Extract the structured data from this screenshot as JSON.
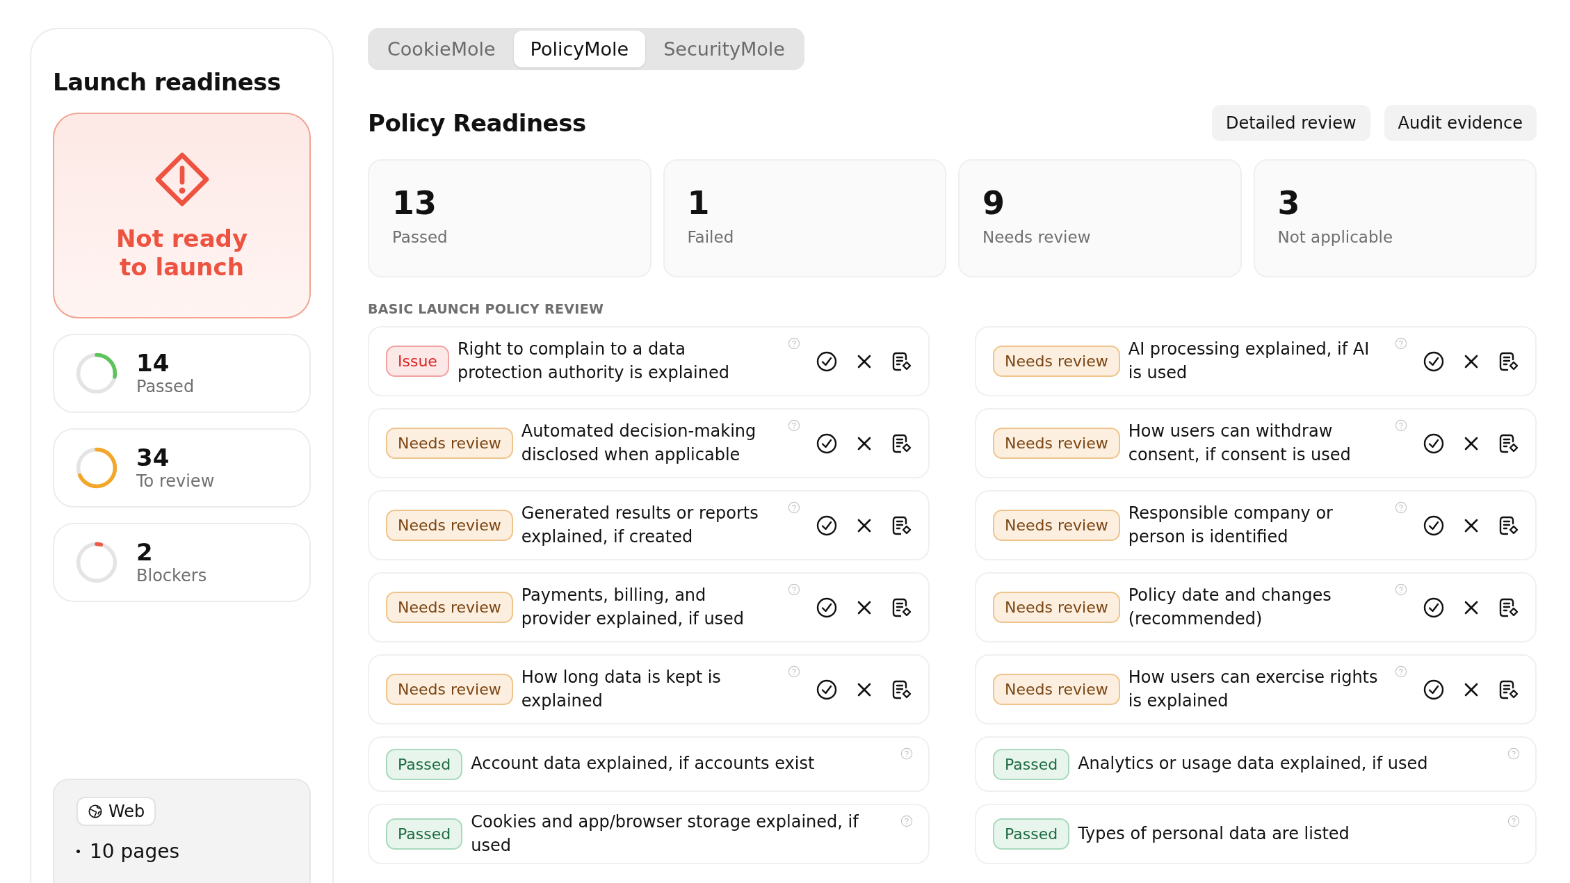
{
  "sidebar": {
    "title": "Launch readiness",
    "verdict": {
      "text": "Not ready to launch",
      "ready": false
    },
    "stats": [
      {
        "value": "14",
        "label": "Passed",
        "level": 0.28,
        "color": "#5cc45a"
      },
      {
        "value": "34",
        "label": "To review",
        "level": 0.68,
        "color": "#f4a62a"
      },
      {
        "value": "2",
        "label": "Blockers",
        "level": 0.04,
        "color": "#ee5a45"
      }
    ],
    "platform": {
      "tag": "Web",
      "detail": "10 pages"
    }
  },
  "tabs": [
    {
      "label": "CookieMole",
      "selected": false
    },
    {
      "label": "PolicyMole",
      "selected": true
    },
    {
      "label": "SecurityMole",
      "selected": false
    }
  ],
  "heading": "Policy Readiness",
  "actions": [
    "Detailed review",
    "Audit evidence"
  ],
  "summary": [
    {
      "value": "13",
      "label": "Passed"
    },
    {
      "value": "1",
      "label": "Failed"
    },
    {
      "value": "9",
      "label": "Needs review"
    },
    {
      "value": "3",
      "label": "Not applicable"
    }
  ],
  "section_title": "BASIC LAUNCH POLICY REVIEW",
  "checks": [
    {
      "kind": "issue",
      "badge": "Issue",
      "text": "Right to complain to a data protection authority is explained"
    },
    {
      "kind": "review",
      "badge": "Needs review",
      "text": "AI processing explained, if AI is used"
    },
    {
      "kind": "review",
      "badge": "Needs review",
      "text": "Automated decision-making disclosed when applicable"
    },
    {
      "kind": "review",
      "badge": "Needs review",
      "text": "How users can withdraw consent, if consent is used"
    },
    {
      "kind": "review",
      "badge": "Needs review",
      "text": "Generated results or reports explained, if created"
    },
    {
      "kind": "review",
      "badge": "Needs review",
      "text": "Responsible company or person is identified"
    },
    {
      "kind": "review",
      "badge": "Needs review",
      "text": "Payments, billing, and provider explained, if used"
    },
    {
      "kind": "review",
      "badge": "Needs review",
      "text": "Policy date and changes (recommended)"
    },
    {
      "kind": "review",
      "badge": "Needs review",
      "text": "How long data is kept is explained"
    },
    {
      "kind": "review",
      "badge": "Needs review",
      "text": "How users can exercise rights is explained"
    },
    {
      "kind": "passed",
      "badge": "Passed",
      "text": "Account data explained, if accounts exist"
    },
    {
      "kind": "passed",
      "badge": "Passed",
      "text": "Analytics or usage data explained, if used"
    },
    {
      "kind": "passed",
      "badge": "Passed",
      "text": "Cookies and app/browser storage explained, if used"
    },
    {
      "kind": "passed",
      "badge": "Passed",
      "text": "Types of personal data are listed"
    }
  ]
}
